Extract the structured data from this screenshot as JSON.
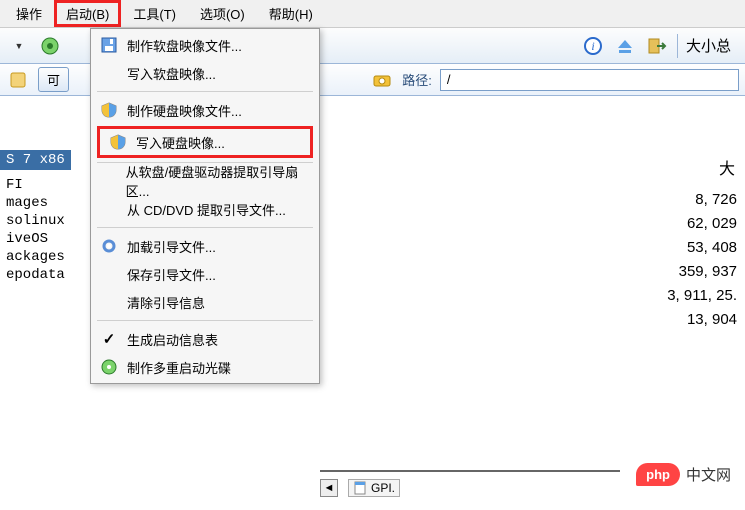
{
  "menubar": {
    "items": [
      {
        "label": "操作"
      },
      {
        "label": "启动(B)"
      },
      {
        "label": "工具(T)"
      },
      {
        "label": "选项(O)"
      },
      {
        "label": "帮助(H)"
      }
    ]
  },
  "toolbar": {
    "total_size_label": "大小总"
  },
  "secondary": {
    "btn_label": "可",
    "path_label": "路径:",
    "path_value": "/"
  },
  "tree": {
    "tab": "S 7 x86",
    "items": [
      "FI",
      "mages",
      "solinux",
      "iveOS",
      "ackages",
      "epodata"
    ]
  },
  "dropdown": {
    "make_floppy": "制作软盘映像文件...",
    "write_floppy": "写入软盘映像...",
    "make_hdd": "制作硬盘映像文件...",
    "write_hdd": "写入硬盘映像...",
    "extract_fd_hd": "从软盘/硬盘驱动器提取引导扇区...",
    "extract_cddvd": "从 CD/DVD 提取引导文件...",
    "load_boot": "加载引导文件...",
    "save_boot": "保存引导文件...",
    "clear_boot": "清除引导信息",
    "gen_boot_table": "生成启动信息表",
    "make_multiboot": "制作多重启动光碟"
  },
  "sizes": {
    "header": "大",
    "rows": [
      "8, 726",
      "62, 029",
      "53, 408",
      "359, 937",
      "3, 911, 25.",
      "13, 904"
    ]
  },
  "bottom": {
    "gpl": "GPI."
  },
  "watermark": {
    "badge": "php",
    "label": "中文网"
  }
}
